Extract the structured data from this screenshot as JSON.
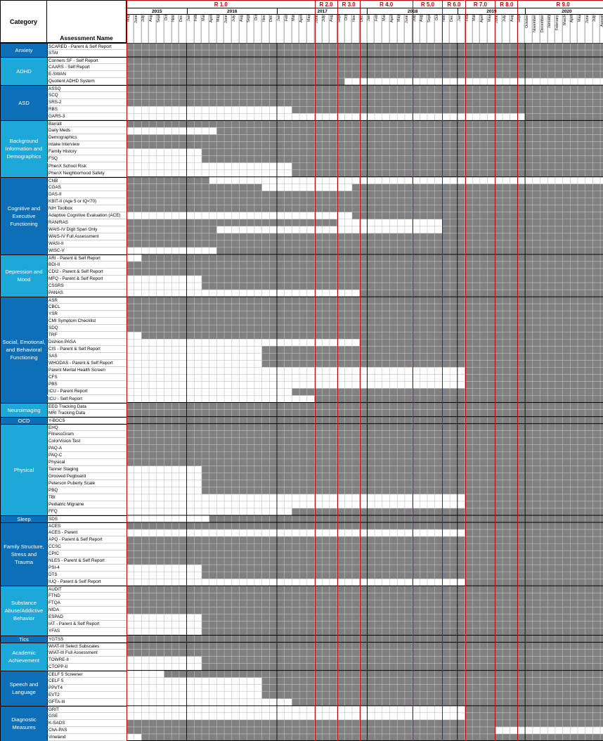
{
  "header": {
    "category_label": "Category",
    "assessment_label": "Assessment Name"
  },
  "colors": {
    "filled": "#808080",
    "empty": "#ffffff",
    "grid": "#bfbfbf",
    "release_line": "#c00000",
    "category_dark": "#0d6fb8",
    "category_light": "#1ca8d8"
  },
  "releases": [
    {
      "label": "R 1.0",
      "start": 0,
      "end": 25
    },
    {
      "label": "R 2.0",
      "start": 25,
      "end": 28
    },
    {
      "label": "R 3.0",
      "start": 28,
      "end": 31
    },
    {
      "label": "R 4.0",
      "start": 31,
      "end": 38
    },
    {
      "label": "R 5.0",
      "start": 38,
      "end": 42
    },
    {
      "label": "R 6.0",
      "start": 42,
      "end": 45
    },
    {
      "label": "R 7.0",
      "start": 45,
      "end": 49
    },
    {
      "label": "R 8.0",
      "start": 49,
      "end": 52
    },
    {
      "label": "R 9.0",
      "start": 52,
      "end": 64
    }
  ],
  "years": [
    {
      "label": "2015",
      "start": 0,
      "end": 8
    },
    {
      "label": "2016",
      "start": 8,
      "end": 20
    },
    {
      "label": "2017",
      "start": 20,
      "end": 32
    },
    {
      "label": "2018",
      "start": 32,
      "end": 44
    },
    {
      "label": "2019",
      "start": 44,
      "end": 53
    },
    {
      "label": "2020",
      "start": 53,
      "end": 64
    }
  ],
  "months": [
    "May",
    "June",
    "July",
    "Aug",
    "Sept",
    "Oct",
    "Nov",
    "Dec",
    "Jan",
    "Feb",
    "Mar",
    "April",
    "May",
    "June",
    "July",
    "Aug",
    "Sept",
    "Oct",
    "Nov",
    "Dec",
    "Jan",
    "Feb",
    "Mar",
    "April",
    "May",
    "June",
    "July",
    "Aug",
    "Sept",
    "Oct",
    "Nov",
    "Dec",
    "Jan",
    "Feb",
    "Mar",
    "April",
    "May",
    "June",
    "July",
    "Aug",
    "Sept",
    "Oct",
    "Nov",
    "Dec",
    "Jan",
    "Feb",
    "Mar",
    "April",
    "May",
    "June",
    "July",
    "Aug",
    "Sept",
    "October",
    "November",
    "December",
    "January",
    "February",
    "March",
    "April",
    "May",
    "June",
    "July",
    "August",
    "September"
  ],
  "categories": [
    {
      "name": "Anxiety",
      "shade": "dark",
      "rows": [
        {
          "name": "SCARED - Parent & Self Report",
          "segs": [
            [
              0,
              65
            ]
          ]
        },
        {
          "name": "STAI",
          "segs": [
            [
              0,
              65
            ]
          ]
        }
      ]
    },
    {
      "name": "ADHD",
      "shade": "light",
      "rows": [
        {
          "name": "Conners SF - Self Report",
          "segs": [
            [
              0,
              65
            ]
          ]
        },
        {
          "name": "CAARS - Self Report",
          "segs": [
            [
              0,
              65
            ]
          ]
        },
        {
          "name": "E-SWAN",
          "segs": [
            [
              0,
              65
            ]
          ]
        },
        {
          "name": "Quotient ADHD System",
          "segs": [
            [
              0,
              29
            ]
          ]
        }
      ]
    },
    {
      "name": "ASD",
      "shade": "dark",
      "rows": [
        {
          "name": "ASSQ",
          "segs": [
            [
              0,
              65
            ]
          ]
        },
        {
          "name": "SCQ",
          "segs": [
            [
              0,
              65
            ]
          ]
        },
        {
          "name": "SRS-2",
          "segs": [
            [
              0,
              65
            ]
          ]
        },
        {
          "name": "RBS",
          "segs": [
            [
              22,
              65
            ]
          ]
        },
        {
          "name": "GARS-3",
          "segs": [
            [
              53,
              65
            ]
          ]
        }
      ]
    },
    {
      "name": "Background Information and Demographics",
      "shade": "light",
      "rows": [
        {
          "name": "Barratt",
          "segs": [
            [
              0,
              65
            ]
          ]
        },
        {
          "name": "Daily Meds",
          "segs": [
            [
              12,
              65
            ]
          ]
        },
        {
          "name": "Demographics",
          "segs": [
            [
              0,
              65
            ]
          ]
        },
        {
          "name": "Intake Interview",
          "segs": [
            [
              0,
              65
            ]
          ]
        },
        {
          "name": "Family History",
          "segs": [
            [
              10,
              65
            ]
          ]
        },
        {
          "name": "FSQ",
          "segs": [
            [
              10,
              65
            ]
          ]
        },
        {
          "name": "PhenX School Risk",
          "segs": [
            [
              22,
              65
            ]
          ]
        },
        {
          "name": "PhenX Neighborhood Safety",
          "segs": [
            [
              22,
              65
            ]
          ]
        }
      ]
    },
    {
      "name": "Cognitive and Executive Functioning",
      "shade": "dark",
      "rows": [
        {
          "name": "CNB",
          "segs": [
            [
              0,
              11
            ]
          ]
        },
        {
          "name": "CGAS",
          "segs": [
            [
              0,
              18
            ],
            [
              30,
              65
            ]
          ]
        },
        {
          "name": "DAS-II",
          "segs": [
            [
              0,
              65
            ]
          ]
        },
        {
          "name": "KBIT-II (Age 5 or IQ<70)",
          "segs": [
            [
              0,
              65
            ]
          ]
        },
        {
          "name": "NIH Toolbox",
          "segs": [
            [
              0,
              65
            ]
          ]
        },
        {
          "name": "Adaptive Cognitive Evaluation (ACE)",
          "segs": [
            [
              30,
              65
            ]
          ]
        },
        {
          "name": "RAN/RAS",
          "segs": [
            [
              0,
              28
            ],
            [
              42,
              65
            ]
          ]
        },
        {
          "name": "WAIS-IV Digit Span Only",
          "segs": [
            [
              0,
              12
            ],
            [
              42,
              65
            ]
          ]
        },
        {
          "name": "WAIS-IV Full Assessment",
          "segs": [
            [
              0,
              65
            ]
          ]
        },
        {
          "name": "WASI-II",
          "segs": [
            [
              0,
              65
            ]
          ]
        },
        {
          "name": "WISC-V",
          "segs": [
            [
              12,
              65
            ]
          ]
        }
      ]
    },
    {
      "name": "Depression and Mood",
      "shade": "light",
      "rows": [
        {
          "name": "ARI - Parent & Self Report",
          "segs": [
            [
              2,
              65
            ]
          ]
        },
        {
          "name": "BDI-II",
          "segs": [
            [
              0,
              65
            ]
          ]
        },
        {
          "name": "CDI2 - Parent & Self Report",
          "segs": [
            [
              0,
              65
            ]
          ]
        },
        {
          "name": "MFQ - Parent & Self Report",
          "segs": [
            [
              10,
              65
            ]
          ]
        },
        {
          "name": "CSSRS",
          "segs": [
            [
              10,
              65
            ]
          ]
        },
        {
          "name": "PANAS",
          "segs": [
            [
              31,
              65
            ]
          ]
        }
      ]
    },
    {
      "name": "Social, Emotional, and Behavioral Functioning",
      "shade": "dark",
      "rows": [
        {
          "name": "ASR",
          "segs": [
            [
              0,
              65
            ]
          ]
        },
        {
          "name": "CBCL",
          "segs": [
            [
              0,
              65
            ]
          ]
        },
        {
          "name": "YSR",
          "segs": [
            [
              0,
              65
            ]
          ]
        },
        {
          "name": "CMI Symptom Checklist",
          "segs": [
            [
              0,
              65
            ]
          ]
        },
        {
          "name": "SDQ",
          "segs": [
            [
              0,
              65
            ]
          ]
        },
        {
          "name": "TRF",
          "segs": [
            [
              2,
              65
            ]
          ]
        },
        {
          "name": "Dishion PASA",
          "segs": [
            [
              31,
              65
            ]
          ]
        },
        {
          "name": "CIS - Parent & Self Report",
          "segs": [
            [
              18,
              65
            ]
          ]
        },
        {
          "name": "SAS",
          "segs": [
            [
              18,
              65
            ]
          ]
        },
        {
          "name": "WHODAS - Parent & Self Report",
          "segs": [
            [
              18,
              65
            ]
          ]
        },
        {
          "name": "Parent Mental Health Screen",
          "segs": [
            [
              45,
              65
            ]
          ]
        },
        {
          "name": "CFS",
          "segs": [
            [
              45,
              65
            ]
          ]
        },
        {
          "name": "PBS",
          "segs": [
            [
              45,
              65
            ]
          ]
        },
        {
          "name": "ICU - Parent Report",
          "segs": [
            [
              22,
              65
            ]
          ]
        },
        {
          "name": "ICU - Self Report",
          "segs": [
            [
              25,
              65
            ]
          ]
        }
      ]
    },
    {
      "name": "Neuroimaging",
      "shade": "light",
      "rows": [
        {
          "name": "EEG Tracking Data",
          "segs": [
            [
              0,
              65
            ]
          ]
        },
        {
          "name": "MRI Tracking Data",
          "segs": [
            [
              0,
              65
            ]
          ]
        }
      ]
    },
    {
      "name": "OCD",
      "shade": "dark",
      "rows": [
        {
          "name": "Y-BOCS",
          "segs": [
            [
              0,
              65
            ]
          ]
        }
      ]
    },
    {
      "name": "Physical",
      "shade": "light",
      "rows": [
        {
          "name": "EHQ",
          "segs": [
            [
              0,
              65
            ]
          ]
        },
        {
          "name": "FitnessGram",
          "segs": [
            [
              0,
              65
            ]
          ]
        },
        {
          "name": "ColorVision Test",
          "segs": [
            [
              0,
              65
            ]
          ]
        },
        {
          "name": "PAQ-A",
          "segs": [
            [
              0,
              65
            ]
          ]
        },
        {
          "name": "PAQ-C",
          "segs": [
            [
              0,
              65
            ]
          ]
        },
        {
          "name": "Physical",
          "segs": [
            [
              0,
              65
            ]
          ]
        },
        {
          "name": "Tanner Staging",
          "segs": [
            [
              10,
              65
            ]
          ]
        },
        {
          "name": "Grooved Pegboard",
          "segs": [
            [
              10,
              65
            ]
          ]
        },
        {
          "name": "Peterson Puberty Scale",
          "segs": [
            [
              10,
              65
            ]
          ]
        },
        {
          "name": "PBQ",
          "segs": [
            [
              10,
              65
            ]
          ]
        },
        {
          "name": "TBI",
          "segs": [
            [
              45,
              65
            ]
          ]
        },
        {
          "name": "Pediatric Migraine",
          "segs": [
            [
              45,
              65
            ]
          ]
        },
        {
          "name": "FFQ",
          "segs": [
            [
              22,
              65
            ]
          ]
        }
      ]
    },
    {
      "name": "Sleep",
      "shade": "dark",
      "rows": [
        {
          "name": "SDS",
          "segs": [
            [
              11,
              65
            ]
          ]
        }
      ]
    },
    {
      "name": "Family Structure, Stress and Trauma",
      "shade": "dark",
      "rows": [
        {
          "name": "ACES",
          "segs": [
            [
              0,
              65
            ]
          ]
        },
        {
          "name": "ACES - Parent",
          "segs": [
            [
              45,
              65
            ]
          ]
        },
        {
          "name": "APQ - Parent & Self Report",
          "segs": [
            [
              0,
              65
            ]
          ]
        },
        {
          "name": "CCSC",
          "segs": [
            [
              0,
              65
            ]
          ]
        },
        {
          "name": "CPIC",
          "segs": [
            [
              0,
              65
            ]
          ]
        },
        {
          "name": "NLES - Parent & Self Report",
          "segs": [
            [
              0,
              65
            ]
          ]
        },
        {
          "name": "PSI-4",
          "segs": [
            [
              10,
              65
            ]
          ]
        },
        {
          "name": "DTS",
          "segs": [
            [
              10,
              65
            ]
          ]
        },
        {
          "name": "IUQ - Parent & Self Report",
          "segs": [
            [
              45,
              65
            ]
          ]
        }
      ]
    },
    {
      "name": "Substance Abuse/Addictive Behavior",
      "shade": "light",
      "rows": [
        {
          "name": "AUDIT",
          "segs": [
            [
              0,
              65
            ]
          ]
        },
        {
          "name": "FTND",
          "segs": [
            [
              0,
              65
            ]
          ]
        },
        {
          "name": "FTQA",
          "segs": [
            [
              0,
              65
            ]
          ]
        },
        {
          "name": "NIDA",
          "segs": [
            [
              0,
              64
            ]
          ]
        },
        {
          "name": "ESPAD",
          "segs": [
            [
              10,
              65
            ]
          ]
        },
        {
          "name": "IAT - Parent & Self Report",
          "segs": [
            [
              10,
              65
            ]
          ]
        },
        {
          "name": "YFAS",
          "segs": [
            [
              10,
              65
            ]
          ]
        }
      ]
    },
    {
      "name": "Tics",
      "shade": "dark",
      "rows": [
        {
          "name": "YGTSS",
          "segs": [
            [
              0,
              65
            ]
          ]
        }
      ]
    },
    {
      "name": "Academic Achievement",
      "shade": "light",
      "rows": [
        {
          "name": "WIAT-III Select Subscales",
          "segs": [
            [
              0,
              65
            ]
          ]
        },
        {
          "name": "WIAT-III Full Assessment",
          "segs": [
            [
              0,
              65
            ]
          ]
        },
        {
          "name": "TOWRE-II",
          "segs": [
            [
              10,
              65
            ]
          ]
        },
        {
          "name": "CTOPP-II",
          "segs": [
            [
              10,
              65
            ]
          ]
        }
      ]
    },
    {
      "name": "Speech and Language",
      "shade": "dark",
      "rows": [
        {
          "name": "CELF 5 Screener",
          "segs": [
            [
              5,
              65
            ]
          ]
        },
        {
          "name": "CELF 5",
          "segs": [
            [
              18,
              65
            ]
          ]
        },
        {
          "name": "PPVT4",
          "segs": [
            [
              18,
              65
            ]
          ]
        },
        {
          "name": "EVT2",
          "segs": [
            [
              18,
              65
            ]
          ]
        },
        {
          "name": "GFTA-III",
          "segs": [
            [
              22,
              65
            ]
          ]
        }
      ]
    },
    {
      "name": "Diagnostic Measures",
      "shade": "dark",
      "rows": [
        {
          "name": "GRIT",
          "segs": [
            [
              45,
              65
            ]
          ]
        },
        {
          "name": "GSE",
          "segs": [
            [
              45,
              65
            ]
          ]
        },
        {
          "name": "K-SADS",
          "segs": [
            [
              0,
              65
            ]
          ]
        },
        {
          "name": "ChA-PAS",
          "segs": [
            [
              0,
              49
            ]
          ]
        },
        {
          "name": "Vineland",
          "segs": [
            [
              2,
              65
            ]
          ]
        }
      ]
    }
  ]
}
